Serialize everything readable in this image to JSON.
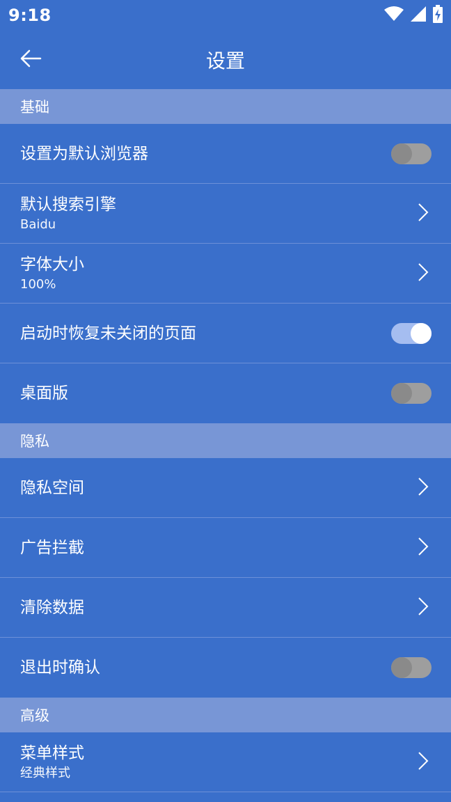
{
  "status_bar": {
    "time": "9:18",
    "icons": [
      "wifi-icon",
      "cell-signal-icon",
      "battery-charging-icon"
    ]
  },
  "app_bar": {
    "title": "设置",
    "back_icon": "arrow-left-icon"
  },
  "colors": {
    "background": "#3a6fcb",
    "section_header": "#7896d6",
    "divider": "#6d90d8",
    "toggle_on_track": "#a5bdf0",
    "toggle_off_track": "#9e9e9e"
  },
  "sections": [
    {
      "title": "基础",
      "items": [
        {
          "label": "设置为默认浏览器",
          "control": "toggle",
          "on": false
        },
        {
          "label": "默认搜索引擎",
          "sub": "Baidu",
          "control": "chevron"
        },
        {
          "label": "字体大小",
          "sub": "100%",
          "control": "chevron"
        },
        {
          "label": "启动时恢复未关闭的页面",
          "control": "toggle",
          "on": true
        },
        {
          "label": "桌面版",
          "control": "toggle",
          "on": false
        }
      ]
    },
    {
      "title": "隐私",
      "items": [
        {
          "label": "隐私空间",
          "control": "chevron"
        },
        {
          "label": "广告拦截",
          "control": "chevron"
        },
        {
          "label": "清除数据",
          "control": "chevron"
        },
        {
          "label": "退出时确认",
          "control": "toggle",
          "on": false
        }
      ]
    },
    {
      "title": "高级",
      "items": [
        {
          "label": "菜单样式",
          "sub": "经典样式",
          "control": "chevron"
        }
      ]
    }
  ]
}
